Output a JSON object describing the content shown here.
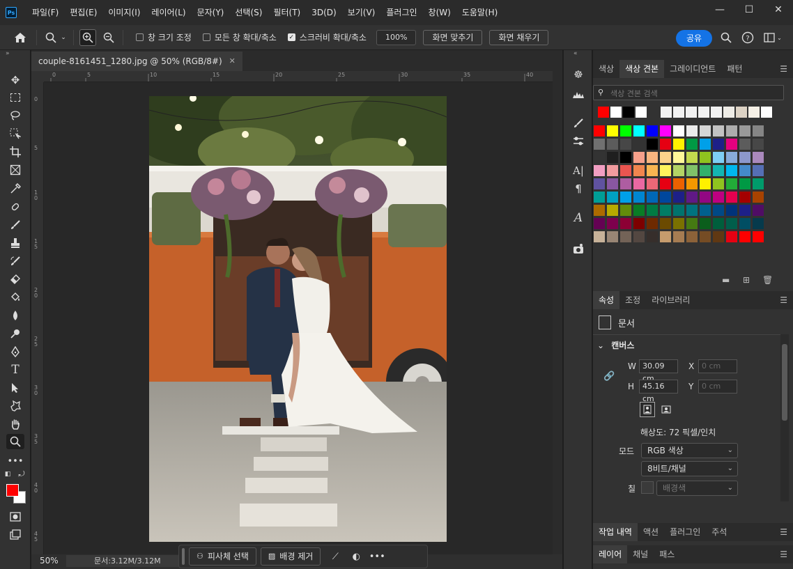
{
  "menu": {
    "logo": "Ps",
    "items": [
      "파일(F)",
      "편집(E)",
      "이미지(I)",
      "레이어(L)",
      "문자(Y)",
      "선택(S)",
      "필터(T)",
      "3D(D)",
      "보기(V)",
      "플러그인",
      "창(W)",
      "도움말(H)"
    ]
  },
  "window_controls": {
    "minimize": "—",
    "maximize": "☐",
    "close": "✕"
  },
  "options_bar": {
    "checkbox_resize_windows": "창 크기 조정",
    "checkbox_zoom_all": "모든 창 확대/축소",
    "checkbox_scrubby": "스크러비 확대/축소",
    "zoom_field": "100%",
    "fit_screen": "화면 맞추기",
    "fill_screen": "화면 채우기",
    "share": "공유"
  },
  "document": {
    "tab_title": "couple-8161451_1280.jpg @ 50% (RGB/8#)",
    "zoom": "50%",
    "doc_size": "문서:3.12M/3.12M",
    "ruler_h_labels": [
      "0",
      "5",
      "10",
      "15",
      "20",
      "25",
      "30",
      "35",
      "40"
    ],
    "ruler_v_labels": [
      "0",
      "5",
      "1\n0",
      "1\n5",
      "2\n0",
      "2\n5",
      "3\n0",
      "3\n5",
      "4\n0",
      "4\n5"
    ]
  },
  "taskbar": {
    "select_subject": "피사체 선택",
    "remove_bg": "배경 제거"
  },
  "swatches_panel": {
    "tabs": [
      "색상",
      "색상 견본",
      "그레이디언트",
      "패턴"
    ],
    "active_tab": "색상 견본",
    "search_placeholder": "색상 견본 검색",
    "recent": [
      "#ff0000",
      "#ffffff",
      "#000000",
      "#ffffff"
    ],
    "recent_gray": [
      "#f2f2f2",
      "#f2f2f2",
      "#f2f2f2",
      "#f2f2f2",
      "#f2f2f2",
      "#eeece6",
      "#ddd3c5",
      "#f5f0e6",
      "#ffffff"
    ],
    "grid": [
      [
        "#ff0000",
        "#ffff00",
        "#00ff00",
        "#00ffff",
        "#0000ff",
        "#ff00ff",
        "#ffffff",
        "#ebebeb",
        "#d6d6d6",
        "#c2c2c2",
        "#adadad",
        "#999999",
        "#858585"
      ],
      [
        "#707070",
        "#5c5c5c",
        "#474747",
        "#333333",
        "#000000",
        "#e60012",
        "#fff100",
        "#009944",
        "#00a0e9",
        "#1d2088",
        "#e4007f",
        "#5c5c5c",
        "#474747"
      ],
      [
        "#333333",
        "#1f1f1f",
        "#000000",
        "#f7a08b",
        "#fab57f",
        "#fcd28a",
        "#fff799",
        "#c3d94e",
        "#8fc31f",
        "#7ecef4",
        "#88abda",
        "#8c97cb",
        "#aa89bd"
      ],
      [
        "#f19ec2",
        "#f29c9f",
        "#ea5550",
        "#f0854e",
        "#f8b551",
        "#fff45c",
        "#b3d465",
        "#80c269",
        "#32b16c",
        "#13b5b1",
        "#00b7ee",
        "#448aca",
        "#556fb5"
      ],
      [
        "#5f52a0",
        "#8957a1",
        "#ae5da1",
        "#ea68a2",
        "#eb6877",
        "#e60012",
        "#eb6100",
        "#f39800",
        "#fff100",
        "#8fc31f",
        "#22ac38",
        "#009944",
        "#009b6b"
      ],
      [
        "#009e96",
        "#00a0c1",
        "#00a0e9",
        "#0086d1",
        "#0068b7",
        "#00479d",
        "#1d2088",
        "#601986",
        "#920783",
        "#be0081",
        "#e5004f",
        "#a40000",
        "#a84200"
      ],
      [
        "#ac6a00",
        "#b7aa00",
        "#638c0b",
        "#097c25",
        "#007b43",
        "#007d65",
        "#00736d",
        "#00737f",
        "#00608d",
        "#004986",
        "#00337a",
        "#1d2088",
        "#500d65"
      ],
      [
        "#640253",
        "#7d004d",
        "#8c0034",
        "#7d0000",
        "#6e2a00",
        "#6b4a00",
        "#7a7100",
        "#457a12",
        "#0b5e1c",
        "#005e3c",
        "#005e4b",
        "#004e63",
        "#063a4c"
      ],
      [
        "#c7b299",
        "#998675",
        "#736357",
        "#534741",
        "#362e2b",
        "#c69c6d",
        "#a67c52",
        "#8c6239",
        "#754c24",
        "#603813",
        "#e60012",
        "#ff0000",
        "#ff0000"
      ]
    ]
  },
  "properties_panel": {
    "tabs": [
      "속성",
      "조정",
      "라이브러리"
    ],
    "active_tab": "속성",
    "doc_label": "문서",
    "section": "캔버스",
    "w_label": "W",
    "w_value": "30.09 cm",
    "h_label": "H",
    "h_value": "45.16 cm",
    "x_label": "X",
    "x_placeholder": "0 cm",
    "y_label": "Y",
    "y_placeholder": "0 cm",
    "resolution": "해상도: 72 픽셀/인치",
    "mode_label": "모드",
    "mode_value": "RGB 색상",
    "bit_value": "8비트/채널",
    "fill_label": "칠",
    "fill_value": "배경색"
  },
  "history_panel": {
    "tabs": [
      "작업 내역",
      "액션",
      "플러그인",
      "주석"
    ],
    "active_tab": "작업 내역"
  },
  "layers_panel": {
    "tabs": [
      "레이어",
      "채널",
      "패스"
    ],
    "active_tab": "레이어"
  },
  "colors": {
    "foreground": "#ff0000",
    "background": "#ffffff",
    "accent": "#1473e6"
  }
}
